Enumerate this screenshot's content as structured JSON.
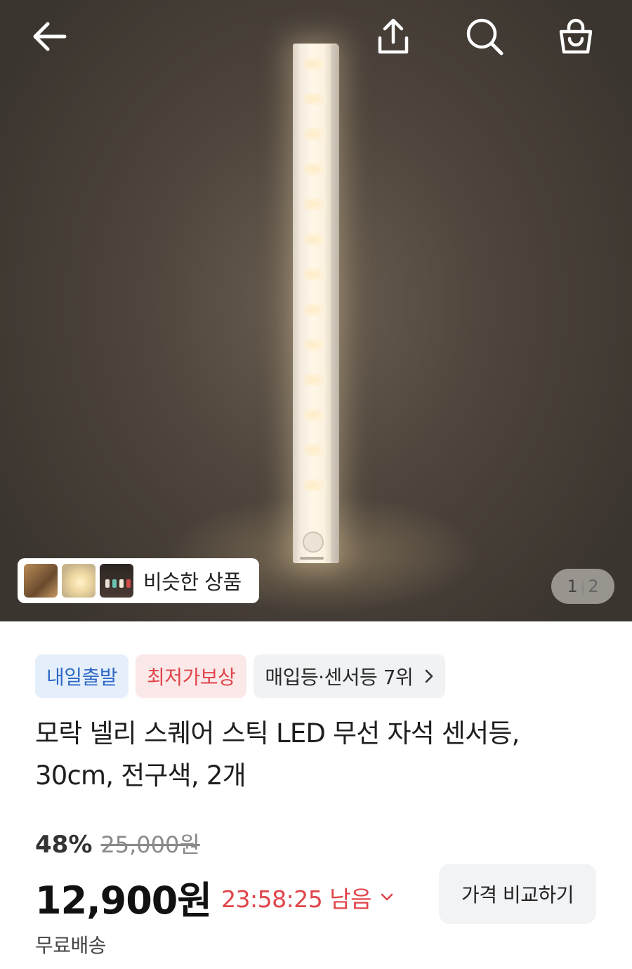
{
  "header": {
    "back_icon": "arrow-left-icon",
    "share_icon": "share-upload-icon",
    "search_icon": "search-icon",
    "cart_icon": "shopping-bag-icon"
  },
  "gallery": {
    "similar_label": "비슷한 상품",
    "current_page": "1",
    "page_separator": "|",
    "total_pages": "2"
  },
  "badges": {
    "delivery": "내일출발",
    "lowest_price": "최저가보상",
    "ranking": "매입등·센서등 7위"
  },
  "product": {
    "title_line1": "모락 넬리 스퀘어 스틱 LED 무선 자석 센서등,",
    "title_line2": "30cm, 전구색, 2개",
    "discount": "48%",
    "original_price": "25,000원",
    "price": "12,900원",
    "timer": "23:58:25 남음",
    "compare_button": "가격 비교하기",
    "shipping": "무료배송"
  },
  "colors": {
    "accent_red": "#e0454b",
    "accent_blue": "#2f69c4"
  }
}
